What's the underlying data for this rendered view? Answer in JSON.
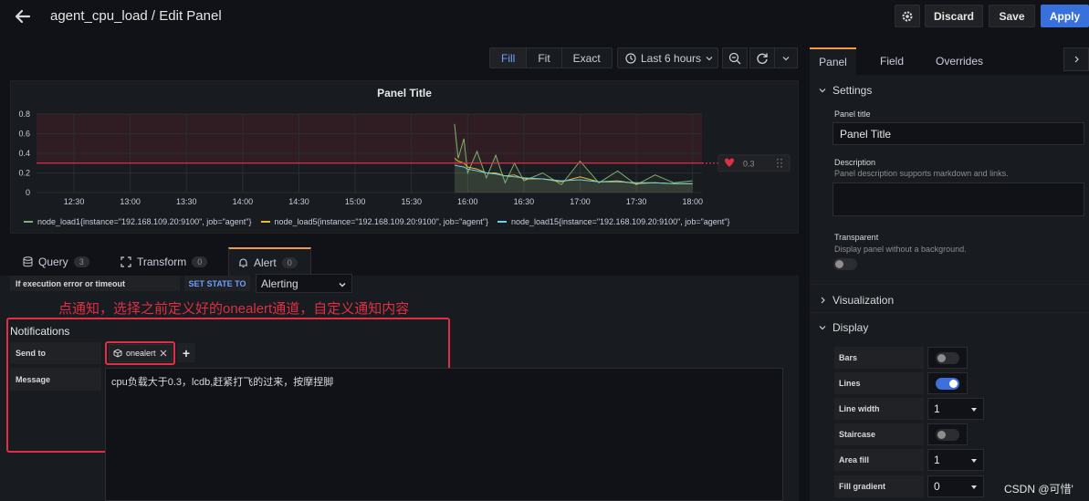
{
  "header": {
    "title": "agent_cpu_load / Edit Panel",
    "discard_label": "Discard",
    "save_label": "Save",
    "apply_label": "Apply"
  },
  "toolbar": {
    "view_modes": [
      "Fill",
      "Fit",
      "Exact"
    ],
    "active_view_mode": "Fill",
    "time_range": "Last 6 hours"
  },
  "panel": {
    "title": "Panel Title",
    "threshold_label": "0.3"
  },
  "chart_data": {
    "type": "line",
    "title": "Panel Title",
    "x_ticks": [
      "12:30",
      "13:00",
      "13:30",
      "14:00",
      "14:30",
      "15:00",
      "15:30",
      "16:00",
      "16:30",
      "17:00",
      "17:30",
      "18:00"
    ],
    "y_ticks": [
      "0",
      "0.2",
      "0.4",
      "0.6",
      "0.8"
    ],
    "ylim": [
      0,
      0.8
    ],
    "threshold": 0.3,
    "threshold_color": "#e02f44",
    "grid": true,
    "legend_position": "bottom",
    "series": [
      {
        "name": "node_load1{instance=\"192.168.109.20:9100\", job=\"agent\"}",
        "color": "#7eb26d",
        "x": [
          "15:53",
          "15:55",
          "15:58",
          "16:00",
          "16:05",
          "16:10",
          "16:15",
          "16:20",
          "16:25",
          "16:30",
          "16:40",
          "16:50",
          "17:00",
          "17:10",
          "17:20",
          "17:30",
          "17:40",
          "17:50",
          "18:00"
        ],
        "values": [
          0.7,
          0.35,
          0.55,
          0.2,
          0.42,
          0.15,
          0.38,
          0.1,
          0.3,
          0.12,
          0.2,
          0.08,
          0.32,
          0.1,
          0.22,
          0.08,
          0.18,
          0.1,
          0.12
        ]
      },
      {
        "name": "node_load5{instance=\"192.168.109.20:9100\", job=\"agent\"}",
        "color": "#eab839",
        "x": [
          "15:53",
          "15:55",
          "15:58",
          "16:00",
          "16:05",
          "16:10",
          "16:15",
          "16:20",
          "16:25",
          "16:30",
          "16:40",
          "16:50",
          "17:00",
          "17:10",
          "17:20",
          "17:30",
          "17:40",
          "17:50",
          "18:00"
        ],
        "values": [
          0.35,
          0.32,
          0.3,
          0.26,
          0.24,
          0.2,
          0.2,
          0.17,
          0.18,
          0.14,
          0.14,
          0.11,
          0.16,
          0.11,
          0.12,
          0.09,
          0.1,
          0.09,
          0.09
        ]
      },
      {
        "name": "node_load15{instance=\"192.168.109.20:9100\", job=\"agent\"}",
        "color": "#6ed0e0",
        "x": [
          "15:53",
          "15:55",
          "15:58",
          "16:00",
          "16:05",
          "16:10",
          "16:15",
          "16:20",
          "16:25",
          "16:30",
          "16:40",
          "16:50",
          "17:00",
          "17:10",
          "17:20",
          "17:30",
          "17:40",
          "17:50",
          "18:00"
        ],
        "values": [
          0.28,
          0.27,
          0.26,
          0.24,
          0.22,
          0.2,
          0.19,
          0.17,
          0.16,
          0.15,
          0.14,
          0.12,
          0.13,
          0.11,
          0.11,
          0.1,
          0.1,
          0.09,
          0.09
        ]
      }
    ]
  },
  "query_tabs": [
    {
      "label": "Query",
      "count": "3"
    },
    {
      "label": "Transform",
      "count": "0"
    },
    {
      "label": "Alert",
      "count": "0"
    }
  ],
  "alert": {
    "exec_error_label": "If execution error or timeout",
    "set_state_label": "SET STATE TO",
    "state_value": "Alerting",
    "annotation": "点通知，选择之前定义好的onealert通道，自定义通知内容",
    "notifications_heading": "Notifications",
    "send_to_label": "Send to",
    "channel": "onealert",
    "message_label": "Message",
    "message": "cpu负载大于0.3，lcdb,赶紧打飞的过来，按摩捏脚"
  },
  "options": {
    "tabs": [
      "Panel",
      "Field",
      "Overrides"
    ],
    "settings_heading": "Settings",
    "panel_title_label": "Panel title",
    "panel_title_value": "Panel Title",
    "description_label": "Description",
    "description_help": "Panel description supports markdown and links.",
    "transparent_label": "Transparent",
    "transparent_help": "Display panel without a background.",
    "visualization_heading": "Visualization",
    "display_heading": "Display",
    "bars_label": "Bars",
    "lines_label": "Lines",
    "line_width_label": "Line width",
    "line_width_value": "1",
    "staircase_label": "Staircase",
    "area_fill_label": "Area fill",
    "area_fill_value": "1",
    "fill_gradient_label": "Fill gradient",
    "fill_gradient_value": "0"
  },
  "watermark": "CSDN @可惜'"
}
